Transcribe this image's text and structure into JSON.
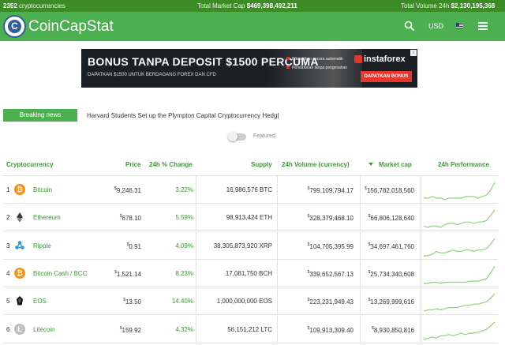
{
  "topbar": {
    "crypto_count": "2352",
    "crypto_label": "cryptocurrencies",
    "market_cap_label": "Total Market Cap",
    "market_cap_value": "$469,398,492,211",
    "volume_label": "Total Volume 24h",
    "volume_value": "$2,130,195,368"
  },
  "navbar": {
    "logo_letter": "C",
    "brand": "CoinCapStat",
    "currency": "USD",
    "search_icon": "search-icon",
    "flag_icon": "us-flag-icon",
    "menu_icon": "hamburger-menu-icon"
  },
  "ad": {
    "headline": "BONUS TANPA DEPOSIT $1500 PERCUMA",
    "subline": "DAPATKAN $1500 UNTUK BERDAGANG FOREX DAN CFD",
    "bullet1": "Dikreditkan secara automatik",
    "bullet2": "Pendaftaran tanpa pengesahan",
    "brand": "instaforex",
    "cta": "DAPATKAN BONUS",
    "close": "x"
  },
  "news": {
    "button": "Breaking news",
    "ticker": "Harvard Students Set up the Plympton Capital Cryptocurrency Hedg|"
  },
  "featured_label": "Featured",
  "table": {
    "headers": {
      "crypto": "Cryptocurrency",
      "price": "Price",
      "change": "24h % Change",
      "supply": "Supply",
      "volume": "24h Volume (currency)",
      "mcap": "Market cap",
      "perf": "24h Performance"
    },
    "rows": [
      {
        "rank": "1",
        "name": "Bitcoin",
        "symbol": "BTC",
        "icon_glyph": "₿",
        "price": "9,246.31",
        "change": "3.22%",
        "supply": "16,986,576 BTC",
        "volume": "799,109,794.17",
        "mcap": "156,782,018,560",
        "spark": [
          4,
          4,
          5,
          4,
          4,
          3,
          4,
          4,
          4,
          4,
          5,
          5,
          5,
          4,
          5,
          6,
          9,
          14
        ]
      },
      {
        "rank": "2",
        "name": "Ethereum",
        "symbol": "ETH",
        "icon_glyph": "",
        "price": "678.10",
        "change": "5.59%",
        "supply": "98,913,424 ETH",
        "volume": "328,379,468.10",
        "mcap": "66,806,128,640",
        "spark": [
          4,
          3,
          4,
          4,
          3,
          5,
          6,
          6,
          5,
          6,
          7,
          7,
          6,
          7,
          7,
          8,
          12,
          16
        ]
      },
      {
        "rank": "3",
        "name": "Ripple",
        "symbol": "XRP",
        "icon_glyph": "",
        "price": "0.91",
        "change": "4.09%",
        "supply": "38,305,873,920 XRP",
        "volume": "104,705,395.99",
        "mcap": "34,697,461,760",
        "spark": [
          3,
          3,
          4,
          6,
          5,
          5,
          6,
          7,
          6,
          6,
          7,
          7,
          6,
          7,
          7,
          8,
          11,
          15
        ]
      },
      {
        "rank": "4",
        "name": "Bitcoin Cash / BCC",
        "symbol": "BCH",
        "icon_glyph": "₿",
        "price": "1,521.14",
        "change": "8.23%",
        "supply": "17,081,750 BCH",
        "volume": "339,652,567.13",
        "mcap": "25,734,340,608",
        "spark": [
          2,
          2,
          3,
          3,
          2,
          3,
          3,
          3,
          3,
          3,
          3,
          4,
          4,
          4,
          5,
          6,
          11,
          17
        ]
      },
      {
        "rank": "5",
        "name": "EOS",
        "symbol": "EOS",
        "icon_glyph": "",
        "price": "13.50",
        "change": "14.40%",
        "supply": "1,000,000,000 EOS",
        "volume": "223,231,949.43",
        "mcap": "13,269,999,616",
        "spark": [
          2,
          3,
          3,
          4,
          3,
          4,
          5,
          5,
          5,
          6,
          7,
          7,
          8,
          8,
          9,
          10,
          13,
          17
        ]
      },
      {
        "rank": "6",
        "name": "Litecoin",
        "symbol": "LTC",
        "icon_glyph": "Ł",
        "price": "159.92",
        "change": "4.32%",
        "supply": "56,151,212 LTC",
        "volume": "109,913,309.40",
        "mcap": "8,930,850,816",
        "spark": [
          3,
          4,
          5,
          4,
          6,
          6,
          7,
          6,
          7,
          8,
          7,
          8,
          8,
          9,
          10,
          11,
          14,
          17
        ]
      }
    ]
  },
  "colors": {
    "topbar": "#3d8b26",
    "navbar": "#4caf50",
    "accent": "#3d9b35",
    "ad_red": "#e8352b"
  }
}
